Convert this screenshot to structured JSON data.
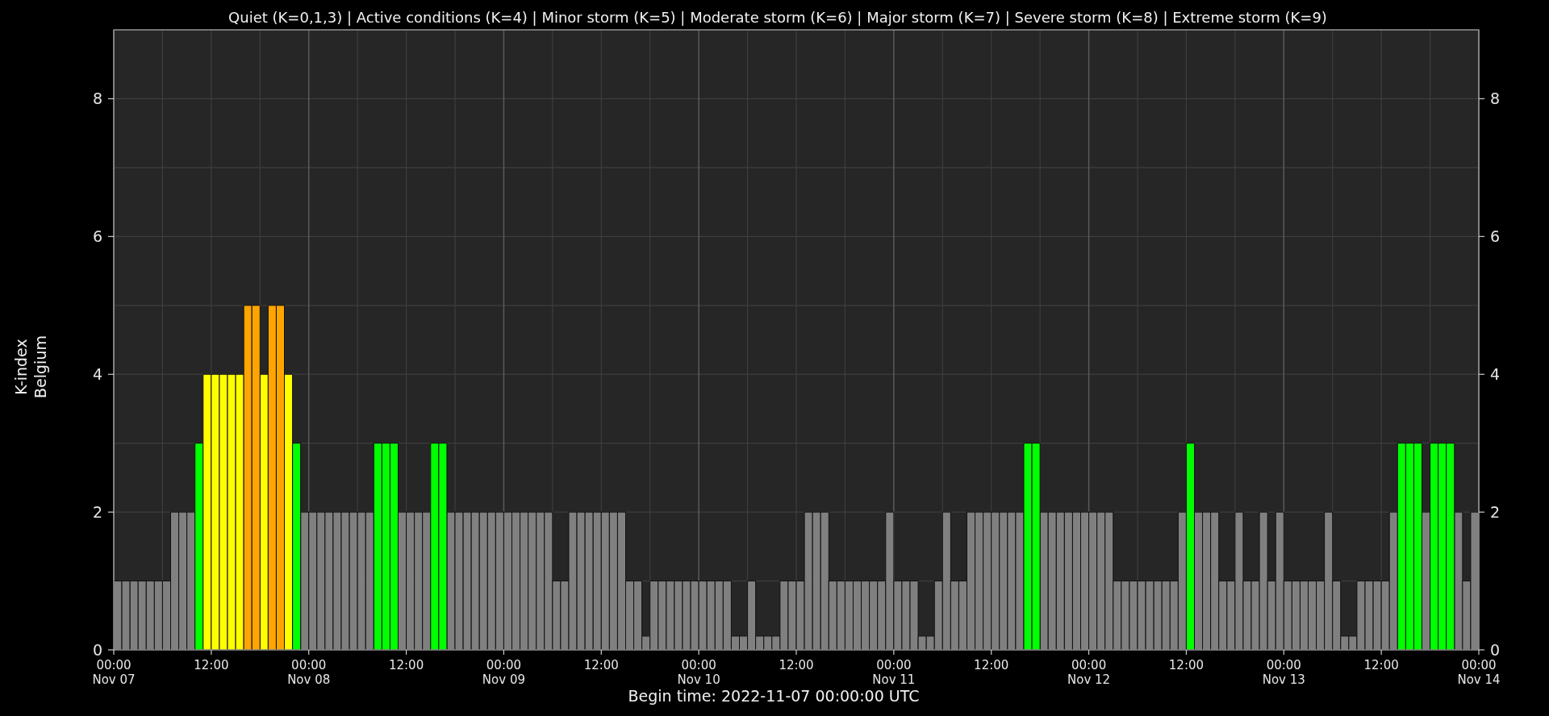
{
  "chart_data": {
    "type": "bar",
    "title": "Quiet (K=0,1,3) | Active conditions (K=4) | Minor storm (K=5) | Moderate storm (K=6) | Major storm (K=7) | Severe storm (K=8) | Extreme storm (K=9)",
    "xlabel": "Begin time: 2022-11-07 00:00:00 UTC",
    "ylabel": "K-index\nBelgium",
    "grid": true,
    "x": [
      "2022-11-07T00:00",
      "2022-11-07T01:00",
      "2022-11-07T02:00",
      "2022-11-07T03:00",
      "2022-11-07T04:00",
      "2022-11-07T05:00",
      "2022-11-07T06:00",
      "2022-11-07T07:00",
      "2022-11-07T08:00",
      "2022-11-07T09:00",
      "2022-11-07T10:00",
      "2022-11-07T11:00",
      "2022-11-07T12:00",
      "2022-11-07T13:00",
      "2022-11-07T14:00",
      "2022-11-07T15:00",
      "2022-11-07T16:00",
      "2022-11-07T17:00",
      "2022-11-07T18:00",
      "2022-11-07T19:00",
      "2022-11-07T20:00",
      "2022-11-07T21:00",
      "2022-11-07T22:00",
      "2022-11-07T23:00",
      "2022-11-08T00:00",
      "2022-11-08T01:00",
      "2022-11-08T02:00",
      "2022-11-08T03:00",
      "2022-11-08T04:00",
      "2022-11-08T05:00",
      "2022-11-08T06:00",
      "2022-11-08T07:00",
      "2022-11-08T08:00",
      "2022-11-08T09:00",
      "2022-11-08T10:00",
      "2022-11-08T11:00",
      "2022-11-08T12:00",
      "2022-11-08T13:00",
      "2022-11-08T14:00",
      "2022-11-08T15:00",
      "2022-11-08T16:00",
      "2022-11-08T17:00",
      "2022-11-08T18:00",
      "2022-11-08T19:00",
      "2022-11-08T20:00",
      "2022-11-08T21:00",
      "2022-11-08T22:00",
      "2022-11-08T23:00",
      "2022-11-09T00:00",
      "2022-11-09T01:00",
      "2022-11-09T02:00",
      "2022-11-09T03:00",
      "2022-11-09T04:00",
      "2022-11-09T05:00",
      "2022-11-09T06:00",
      "2022-11-09T07:00",
      "2022-11-09T08:00",
      "2022-11-09T09:00",
      "2022-11-09T10:00",
      "2022-11-09T11:00",
      "2022-11-09T12:00",
      "2022-11-09T13:00",
      "2022-11-09T14:00",
      "2022-11-09T15:00",
      "2022-11-09T16:00",
      "2022-11-09T17:00",
      "2022-11-09T18:00",
      "2022-11-09T19:00",
      "2022-11-09T20:00",
      "2022-11-09T21:00",
      "2022-11-09T22:00",
      "2022-11-09T23:00",
      "2022-11-10T00:00",
      "2022-11-10T01:00",
      "2022-11-10T02:00",
      "2022-11-10T03:00",
      "2022-11-10T04:00",
      "2022-11-10T05:00",
      "2022-11-10T06:00",
      "2022-11-10T07:00",
      "2022-11-10T08:00",
      "2022-11-10T09:00",
      "2022-11-10T10:00",
      "2022-11-10T11:00",
      "2022-11-10T12:00",
      "2022-11-10T13:00",
      "2022-11-10T14:00",
      "2022-11-10T15:00",
      "2022-11-10T16:00",
      "2022-11-10T17:00",
      "2022-11-10T18:00",
      "2022-11-10T19:00",
      "2022-11-10T20:00",
      "2022-11-10T21:00",
      "2022-11-10T22:00",
      "2022-11-10T23:00",
      "2022-11-11T00:00",
      "2022-11-11T01:00",
      "2022-11-11T02:00",
      "2022-11-11T03:00",
      "2022-11-11T04:00",
      "2022-11-11T05:00",
      "2022-11-11T06:00",
      "2022-11-11T07:00",
      "2022-11-11T08:00",
      "2022-11-11T09:00",
      "2022-11-11T10:00",
      "2022-11-11T11:00",
      "2022-11-11T12:00",
      "2022-11-11T13:00",
      "2022-11-11T14:00",
      "2022-11-11T15:00",
      "2022-11-11T16:00",
      "2022-11-11T17:00",
      "2022-11-11T18:00",
      "2022-11-11T19:00",
      "2022-11-11T20:00",
      "2022-11-11T21:00",
      "2022-11-11T22:00",
      "2022-11-11T23:00",
      "2022-11-12T00:00",
      "2022-11-12T01:00",
      "2022-11-12T02:00",
      "2022-11-12T03:00",
      "2022-11-12T04:00",
      "2022-11-12T05:00",
      "2022-11-12T06:00",
      "2022-11-12T07:00",
      "2022-11-12T08:00",
      "2022-11-12T09:00",
      "2022-11-12T10:00",
      "2022-11-12T11:00",
      "2022-11-12T12:00",
      "2022-11-12T13:00",
      "2022-11-12T14:00",
      "2022-11-12T15:00",
      "2022-11-12T16:00",
      "2022-11-12T17:00",
      "2022-11-12T18:00",
      "2022-11-12T19:00",
      "2022-11-12T20:00",
      "2022-11-12T21:00",
      "2022-11-12T22:00",
      "2022-11-12T23:00",
      "2022-11-13T00:00",
      "2022-11-13T01:00",
      "2022-11-13T02:00",
      "2022-11-13T03:00",
      "2022-11-13T04:00",
      "2022-11-13T05:00",
      "2022-11-13T06:00",
      "2022-11-13T07:00",
      "2022-11-13T08:00",
      "2022-11-13T09:00",
      "2022-11-13T10:00",
      "2022-11-13T11:00",
      "2022-11-13T12:00",
      "2022-11-13T13:00",
      "2022-11-13T14:00",
      "2022-11-13T15:00",
      "2022-11-13T16:00",
      "2022-11-13T17:00",
      "2022-11-13T18:00",
      "2022-11-13T19:00",
      "2022-11-13T20:00",
      "2022-11-13T21:00",
      "2022-11-13T22:00",
      "2022-11-13T23:00"
    ],
    "xlim": [
      "2022-11-07T00:00",
      "2022-11-14T00:00"
    ],
    "ylim": [
      0,
      9
    ],
    "yticks": [
      0,
      2,
      4,
      6,
      8
    ],
    "annotations": [
      "0",
      "2",
      "4",
      "6",
      "8"
    ],
    "xticks": [
      {
        "value": "2022-11-07T00:00",
        "label": "00:00\nNov 07"
      },
      {
        "value": "2022-11-07T12:00",
        "label": "12:00"
      },
      {
        "value": "2022-11-08T00:00",
        "label": "00:00\nNov 08"
      },
      {
        "value": "2022-11-08T12:00",
        "label": "12:00"
      },
      {
        "value": "2022-11-09T00:00",
        "label": "00:00\nNov 09"
      },
      {
        "value": "2022-11-09T12:00",
        "label": "12:00"
      },
      {
        "value": "2022-11-10T00:00",
        "label": "00:00\nNov 10"
      },
      {
        "value": "2022-11-10T12:00",
        "label": "12:00"
      },
      {
        "value": "2022-11-11T00:00",
        "label": "00:00\nNov 11"
      },
      {
        "value": "2022-11-11T12:00",
        "label": "12:00"
      },
      {
        "value": "2022-11-12T00:00",
        "label": "00:00\nNov 12"
      },
      {
        "value": "2022-11-12T12:00",
        "label": "12:00"
      },
      {
        "value": "2022-11-13T00:00",
        "label": "00:00\nNov 13"
      },
      {
        "value": "2022-11-13T12:00",
        "label": "12:00"
      },
      {
        "value": "2022-11-14T00:00",
        "label": "00:00\nNov 14"
      }
    ],
    "series": [
      {
        "color": "#808080",
        "values": [
          1,
          1,
          1,
          1,
          1,
          1,
          1,
          2,
          2,
          2,
          null,
          null,
          null,
          null,
          null,
          null,
          null,
          null,
          null,
          null,
          null,
          null,
          null,
          2,
          2,
          2,
          2,
          2,
          2,
          2,
          2,
          2,
          null,
          null,
          null,
          2,
          2,
          2,
          2,
          null,
          null,
          2,
          2,
          2,
          2,
          2,
          2,
          2,
          2,
          2,
          2,
          2,
          2,
          2,
          1,
          1,
          2,
          2,
          2,
          2,
          2,
          2,
          2,
          1,
          1,
          0.2,
          1,
          1,
          1,
          1,
          1,
          1,
          1,
          1,
          1,
          1,
          0.2,
          0.2,
          1,
          0.2,
          0.2,
          0.2,
          1,
          1,
          1,
          2,
          2,
          2,
          1,
          1,
          1,
          1,
          1,
          1,
          1,
          2,
          1,
          1,
          1,
          0.2,
          0.2,
          1,
          2,
          1,
          1,
          2,
          2,
          2,
          2,
          2,
          2,
          2,
          null,
          null,
          2,
          2,
          2,
          2,
          2,
          2,
          2,
          2,
          2,
          1,
          1,
          1,
          1,
          1,
          1,
          1,
          1,
          2,
          null,
          2,
          2,
          2,
          1,
          1,
          2,
          1,
          1,
          2,
          1,
          2,
          1,
          1,
          1,
          1,
          1,
          2,
          1,
          0.2,
          0.2,
          1,
          1,
          1,
          1,
          2,
          null,
          null,
          null,
          2,
          null,
          null,
          null,
          2,
          1,
          2
        ]
      },
      {
        "color": "#00ff00",
        "values": [
          null,
          null,
          null,
          null,
          null,
          null,
          null,
          null,
          null,
          null,
          3,
          null,
          null,
          null,
          null,
          null,
          null,
          null,
          null,
          null,
          null,
          null,
          3,
          null,
          null,
          null,
          null,
          null,
          null,
          null,
          null,
          null,
          3,
          3,
          3,
          null,
          null,
          null,
          null,
          3,
          3,
          null,
          null,
          null,
          null,
          null,
          null,
          null,
          null,
          null,
          null,
          null,
          null,
          null,
          null,
          null,
          null,
          null,
          null,
          null,
          null,
          null,
          null,
          null,
          null,
          null,
          null,
          null,
          null,
          null,
          null,
          null,
          null,
          null,
          null,
          null,
          null,
          null,
          null,
          null,
          null,
          null,
          null,
          null,
          null,
          null,
          null,
          null,
          null,
          null,
          null,
          null,
          null,
          null,
          null,
          null,
          null,
          null,
          null,
          null,
          null,
          null,
          null,
          null,
          null,
          null,
          null,
          null,
          null,
          null,
          null,
          null,
          3,
          3,
          null,
          null,
          null,
          null,
          null,
          null,
          null,
          null,
          null,
          null,
          null,
          null,
          null,
          null,
          null,
          null,
          null,
          null,
          3,
          null,
          null,
          null,
          null,
          null,
          null,
          null,
          null,
          null,
          null,
          null,
          null,
          null,
          null,
          null,
          null,
          null,
          null,
          null,
          null,
          null,
          null,
          null,
          null,
          null,
          3,
          3,
          3,
          null,
          3,
          3,
          3,
          null,
          null,
          null
        ]
      },
      {
        "color": "#ffff00",
        "values": [
          null,
          null,
          null,
          null,
          null,
          null,
          null,
          null,
          null,
          null,
          null,
          4,
          4,
          4,
          4,
          4,
          null,
          null,
          4,
          null,
          null,
          4,
          null,
          null,
          null,
          null,
          null,
          null,
          null,
          null,
          null,
          null,
          null,
          null,
          null,
          null,
          null,
          null,
          null,
          null,
          null,
          null,
          null,
          null,
          null,
          null,
          null,
          null,
          null,
          null,
          null,
          null,
          null,
          null,
          null,
          null,
          null,
          null,
          null,
          null,
          null,
          null,
          null,
          null,
          null,
          null,
          null,
          null,
          null,
          null,
          null,
          null,
          null,
          null,
          null,
          null,
          null,
          null,
          null,
          null,
          null,
          null,
          null,
          null,
          null,
          null,
          null,
          null,
          null,
          null,
          null,
          null,
          null,
          null,
          null,
          null,
          null,
          null,
          null,
          null,
          null,
          null,
          null,
          null,
          null,
          null,
          null,
          null,
          null,
          null,
          null,
          null,
          null,
          null,
          null,
          null,
          null,
          null,
          null,
          null,
          null,
          null,
          null,
          null,
          null,
          null,
          null,
          null,
          null,
          null,
          null,
          null,
          null,
          null,
          null,
          null,
          null,
          null,
          null,
          null,
          null,
          null,
          null,
          null,
          null,
          null,
          null,
          null,
          null,
          null,
          null,
          null,
          null,
          null,
          null,
          null,
          null,
          null,
          null,
          null,
          null,
          null,
          null,
          null,
          null,
          null,
          null,
          null
        ]
      },
      {
        "color": "#ffa500",
        "values": [
          null,
          null,
          null,
          null,
          null,
          null,
          null,
          null,
          null,
          null,
          null,
          null,
          null,
          null,
          null,
          null,
          5,
          5,
          null,
          5,
          5,
          null,
          null,
          null,
          null,
          null,
          null,
          null,
          null,
          null,
          null,
          null,
          null,
          null,
          null,
          null,
          null,
          null,
          null,
          null,
          null,
          null,
          null,
          null,
          null,
          null,
          null,
          null,
          null,
          null,
          null,
          null,
          null,
          null,
          null,
          null,
          null,
          null,
          null,
          null,
          null,
          null,
          null,
          null,
          null,
          null,
          null,
          null,
          null,
          null,
          null,
          null,
          null,
          null,
          null,
          null,
          null,
          null,
          null,
          null,
          null,
          null,
          null,
          null,
          null,
          null,
          null,
          null,
          null,
          null,
          null,
          null,
          null,
          null,
          null,
          null,
          null,
          null,
          null,
          null,
          null,
          null,
          null,
          null,
          null,
          null,
          null,
          null,
          null,
          null,
          null,
          null,
          null,
          null,
          null,
          null,
          null,
          null,
          null,
          null,
          null,
          null,
          null,
          null,
          null,
          null,
          null,
          null,
          null,
          null,
          null,
          null,
          null,
          null,
          null,
          null,
          null,
          null,
          null,
          null,
          null,
          null,
          null,
          null,
          null,
          null,
          null,
          null,
          null,
          null,
          null,
          null,
          null,
          null,
          null,
          null,
          null,
          null,
          null,
          null,
          null,
          null,
          null,
          null,
          null,
          null,
          null,
          null
        ]
      }
    ]
  }
}
